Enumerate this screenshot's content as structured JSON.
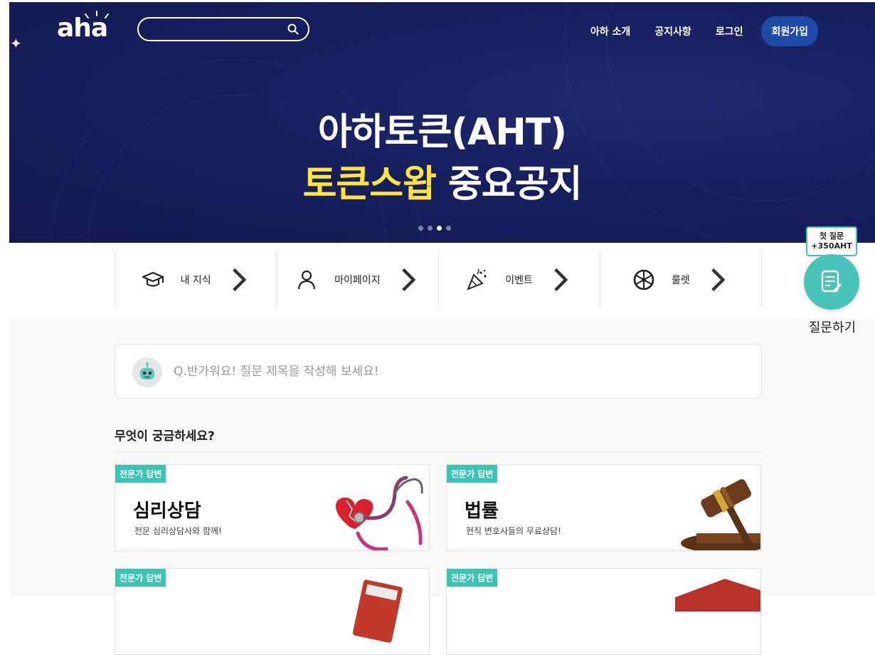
{
  "header": {
    "logo_text": "aha",
    "search_placeholder": "",
    "nav": [
      "아하 소개",
      "공지사항",
      "로그인"
    ],
    "signup_label": "회원가입"
  },
  "banner": {
    "line1": "아하토큰(AHT)",
    "line2_highlight": "토큰스왑",
    "line2_rest": "중요공지",
    "slide_count": 4,
    "active_slide": 3
  },
  "quick_menu": [
    {
      "label": "내 지식",
      "icon": "graduation-cap-icon"
    },
    {
      "label": "마이페이지",
      "icon": "person-icon"
    },
    {
      "label": "이벤트",
      "icon": "party-popper-icon"
    },
    {
      "label": "룰렛",
      "icon": "roulette-wheel-icon"
    }
  ],
  "question_box": {
    "placeholder": "Q.반가워요! 질문 제목을 작성해 보세요!"
  },
  "section_title": "무엇이 궁금하세요?",
  "cards": [
    {
      "badge": "전문가 답변",
      "title": "심리상담",
      "subtitle": "전문 심리상담사와 함께!"
    },
    {
      "badge": "전문가 답변",
      "title": "법률",
      "subtitle": "현직 변호사들의 무료상담!"
    },
    {
      "badge": "전문가 답변",
      "title": "",
      "subtitle": ""
    },
    {
      "badge": "전문가 답변",
      "title": "",
      "subtitle": ""
    }
  ],
  "ask": {
    "tip_line1": "첫 질문",
    "tip_line2": "+350AHT",
    "label": "질문하기"
  },
  "colors": {
    "hero_bg": "#172060",
    "highlight": "#ffe53b",
    "accent": "#3bc4b4",
    "signup_bg": "#1e4ba8"
  }
}
